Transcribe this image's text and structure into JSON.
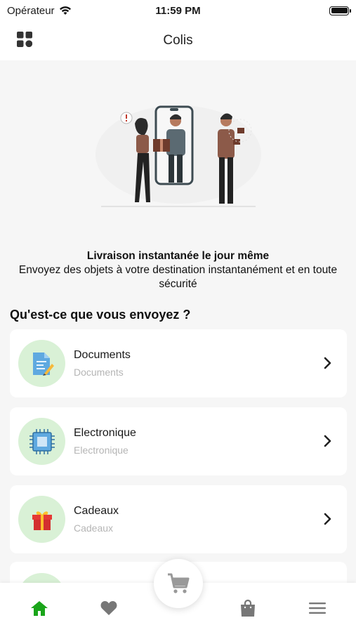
{
  "status_bar": {
    "carrier": "Opérateur",
    "time": "11:59 PM",
    "battery_level": 1.0
  },
  "header": {
    "title": "Colis",
    "menu_icon": "grid-icon"
  },
  "intro": {
    "title": "Livraison instantanée le jour même",
    "subtitle": "Envoyez des objets à votre destination instantanément et en toute sécurité"
  },
  "section": {
    "title": "Qu'est-ce que vous envoyez ?"
  },
  "categories": [
    {
      "name": "Documents",
      "subtitle": "Documents",
      "icon": "document-icon"
    },
    {
      "name": "Electronique",
      "subtitle": "Electronique",
      "icon": "chip-icon"
    },
    {
      "name": "Cadeaux",
      "subtitle": "Cadeaux",
      "icon": "gift-icon"
    }
  ],
  "tab_bar": {
    "items": [
      "home-icon",
      "heart-icon",
      "cart-icon",
      "bag-icon",
      "menu-icon"
    ],
    "active": "home-icon",
    "active_color": "#1aa51a",
    "inactive_color": "#777777"
  },
  "colors": {
    "accent_green": "#1aa51a",
    "category_circle": "#d9f1d6"
  }
}
